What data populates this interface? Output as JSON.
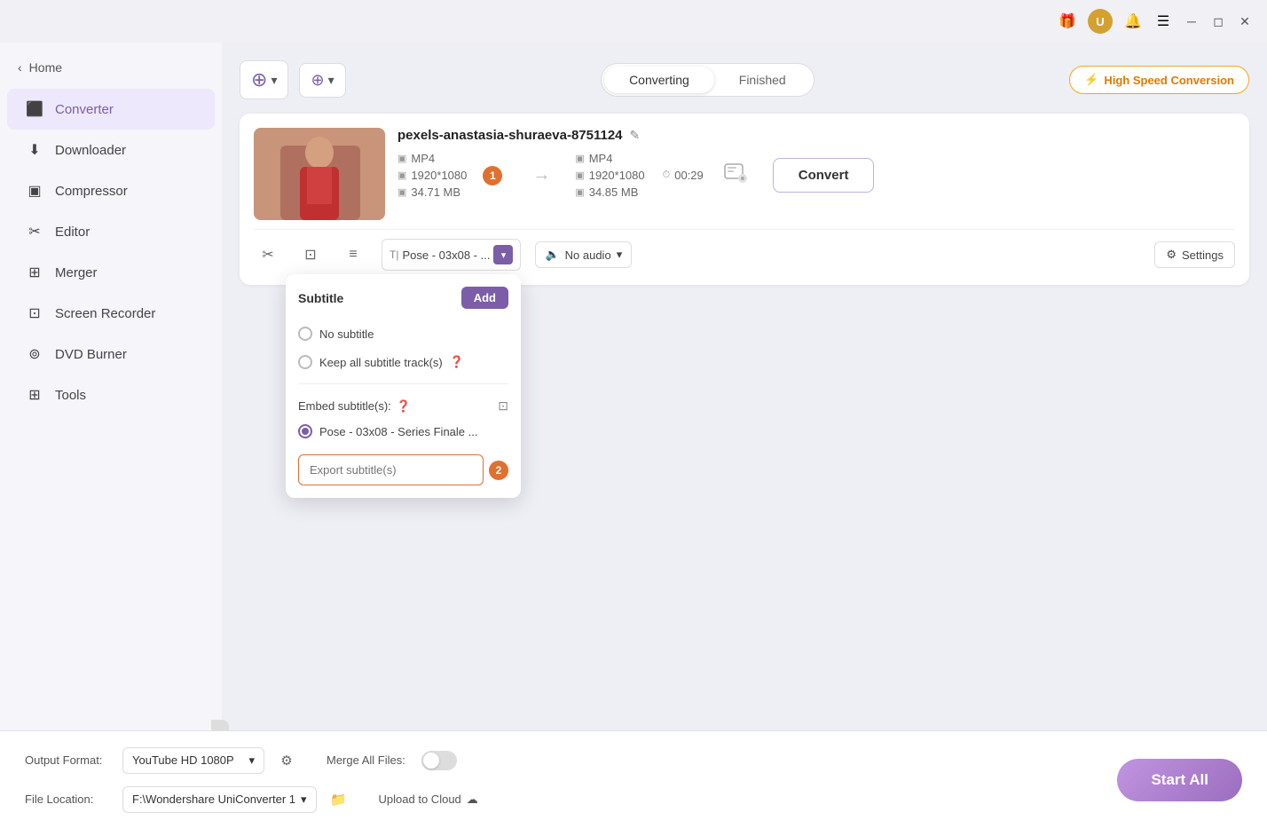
{
  "titlebar": {
    "icons": [
      "gift",
      "avatar",
      "bell",
      "menu",
      "minimize",
      "maximize",
      "close"
    ],
    "avatar_label": "U"
  },
  "sidebar": {
    "back_label": "Home",
    "items": [
      {
        "id": "converter",
        "label": "Converter",
        "active": true
      },
      {
        "id": "downloader",
        "label": "Downloader",
        "active": false
      },
      {
        "id": "compressor",
        "label": "Compressor",
        "active": false
      },
      {
        "id": "editor",
        "label": "Editor",
        "active": false
      },
      {
        "id": "merger",
        "label": "Merger",
        "active": false
      },
      {
        "id": "screen-recorder",
        "label": "Screen Recorder",
        "active": false
      },
      {
        "id": "dvd-burner",
        "label": "DVD Burner",
        "active": false
      },
      {
        "id": "tools",
        "label": "Tools",
        "active": false
      }
    ]
  },
  "toolbar": {
    "add_file_label": "▾",
    "add_files_label": "▾",
    "tab_converting": "Converting",
    "tab_finished": "Finished",
    "high_speed_label": "High Speed Conversion"
  },
  "file_card": {
    "file_name": "pexels-anastasia-shuraeva-8751124",
    "src_format": "MP4",
    "src_resolution": "1920*1080",
    "src_size": "34.71 MB",
    "src_badge": "1",
    "dst_format": "MP4",
    "dst_resolution": "1920*1080",
    "dst_size": "34.85 MB",
    "dst_duration": "00:29",
    "convert_btn": "Convert",
    "subtitle_text": "Pose - 03x08 - ...",
    "audio_text": "No audio",
    "settings_text": "Settings"
  },
  "subtitle_dropdown": {
    "title": "Subtitle",
    "add_btn": "Add",
    "option_no_subtitle": "No subtitle",
    "option_keep_all": "Keep all subtitle track(s)",
    "embed_label": "Embed subtitle(s):",
    "embed_item": "Pose - 03x08 - Series Finale ...",
    "export_placeholder": "Export subtitle(s)",
    "step_badge_1": "1",
    "step_badge_2": "2"
  },
  "bottom_bar": {
    "output_format_label": "Output Format:",
    "output_format_value": "YouTube HD 1080P",
    "file_location_label": "File Location:",
    "file_location_value": "F:\\Wondershare UniConverter 1",
    "merge_files_label": "Merge All Files:",
    "upload_cloud_label": "Upload to Cloud",
    "start_all_btn": "Start All"
  }
}
